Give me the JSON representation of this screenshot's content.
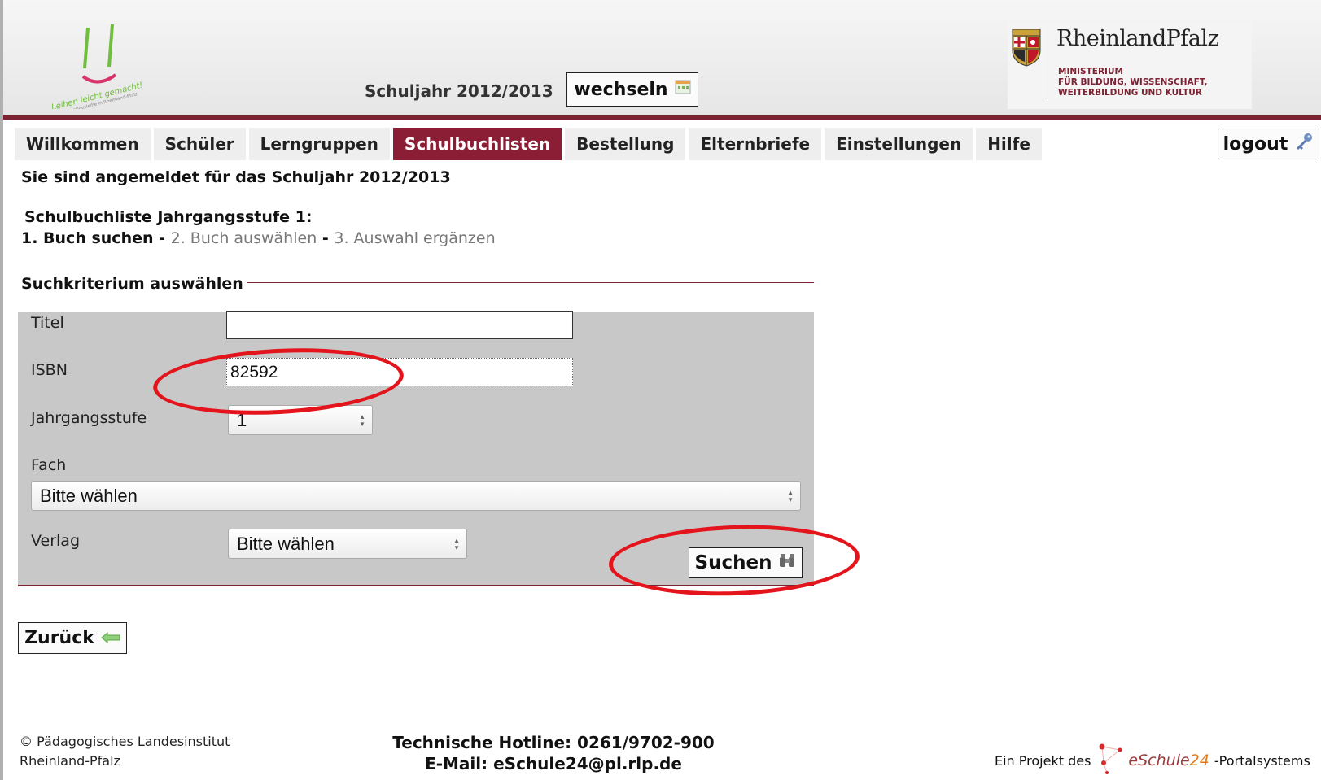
{
  "header": {
    "logo_text": "Leihen leicht gemacht!",
    "logo_subtext": "Schulbuchausleihe in Rheinland-Pfalz",
    "schuljahr_label": "Schuljahr 2012/2013",
    "change_button": "wechseln",
    "ministry_name": "RheinlandPfalz",
    "ministry_lines": [
      "MINISTERIUM",
      "FÜR BILDUNG, WISSENSCHAFT,",
      "WEITERBILDUNG UND KULTUR"
    ]
  },
  "nav": {
    "tabs": [
      {
        "label": "Willkommen"
      },
      {
        "label": "Schüler"
      },
      {
        "label": "Lerngruppen"
      },
      {
        "label": "Schulbuchlisten"
      },
      {
        "label": "Bestellung"
      },
      {
        "label": "Elternbriefe"
      },
      {
        "label": "Einstellungen"
      },
      {
        "label": "Hilfe"
      }
    ],
    "active_tab": "Schulbuchlisten",
    "logout_label": "logout"
  },
  "main": {
    "status": "Sie sind angemeldet für das Schuljahr 2012/2013",
    "list_title": "Schulbuchliste Jahrgangsstufe 1:",
    "steps": {
      "step1": "1. Buch suchen",
      "sep1": " - ",
      "step2": "2. Buch auswählen",
      "sep2": " - ",
      "step3": "3. Auswahl ergänzen"
    },
    "legend": "Suchkriterium auswählen",
    "form": {
      "titel_label": "Titel",
      "titel_value": "",
      "isbn_label": "ISBN",
      "isbn_value": "82592",
      "jahrgangsstufe_label": "Jahrgangsstufe",
      "jahrgangsstufe_value": "1",
      "fach_label": "Fach",
      "fach_value": "Bitte wählen",
      "verlag_label": "Verlag",
      "verlag_value": "Bitte wählen",
      "search_button": "Suchen"
    },
    "back_button": "Zurück"
  },
  "footer": {
    "copyright_line1": "© Pädagogisches Landesinstitut",
    "copyright_line2": "Rheinland-Pfalz",
    "hotline": "Technische Hotline: 0261/9702-900",
    "email": "E-Mail: eSchule24@pl.rlp.de",
    "project_prefix": "Ein Projekt des",
    "brand_main": "eSchule",
    "brand_num": "24",
    "project_suffix": "-Portalsystems"
  },
  "colors": {
    "brand_red": "#8b1e35",
    "annotation_red": "#e3141b",
    "panel_gray": "#c8c8c8"
  }
}
